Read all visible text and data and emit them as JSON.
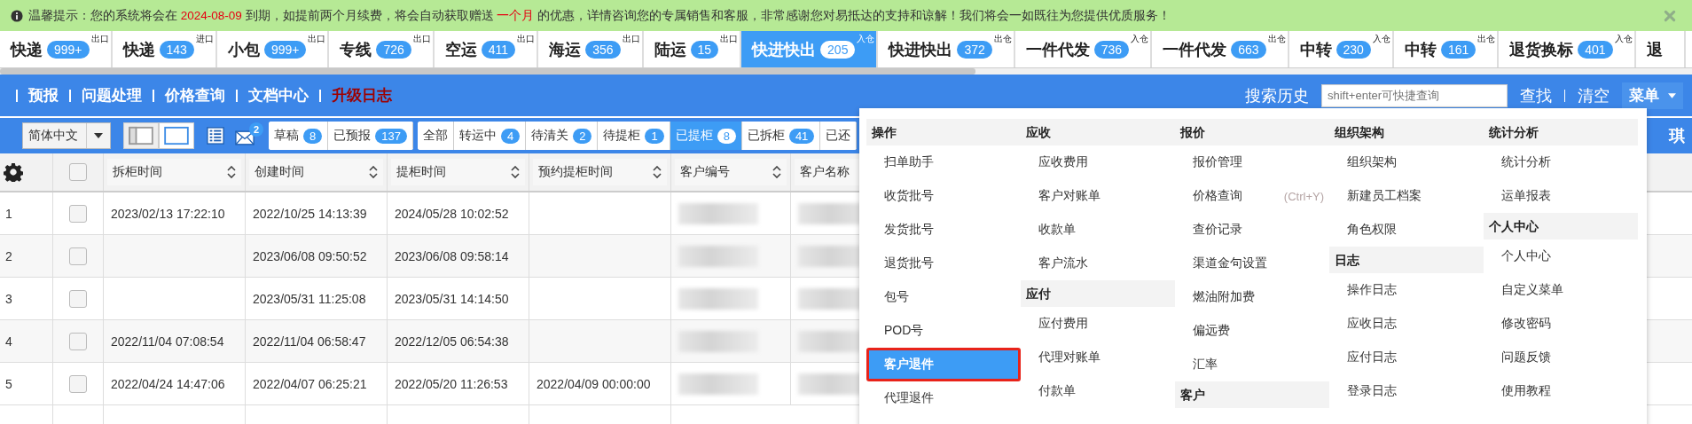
{
  "notice": {
    "segments": [
      {
        "text": "温馨提示：您的系统将会在 ",
        "kind": "plain"
      },
      {
        "text": "2024-08-09",
        "kind": "highlight"
      },
      {
        "text": " 到期，如提前两个月续费，将会自动获取赠送 ",
        "kind": "plain"
      },
      {
        "text": "一个月",
        "kind": "highlight"
      },
      {
        "text": " 的优惠，详情咨询您的专属销售和客服，非常感谢您对易抵达的支持和谅解！我们将会一如既往为您提供优质服务！",
        "kind": "plain"
      }
    ]
  },
  "tabs": [
    {
      "label": "快递",
      "count": "999+",
      "tag": "出口",
      "selected": false
    },
    {
      "label": "快递",
      "count": "143",
      "tag": "进口",
      "selected": false
    },
    {
      "label": "小包",
      "count": "999+",
      "tag": "出口",
      "selected": false
    },
    {
      "label": "专线",
      "count": "726",
      "tag": "出口",
      "selected": false
    },
    {
      "label": "空运",
      "count": "411",
      "tag": "出口",
      "selected": false
    },
    {
      "label": "海运",
      "count": "356",
      "tag": "出口",
      "selected": false
    },
    {
      "label": "陆运",
      "count": "15",
      "tag": "出口",
      "selected": false
    },
    {
      "label": "快进快出",
      "count": "205",
      "tag": "入仓",
      "selected": true
    },
    {
      "label": "快进快出",
      "count": "372",
      "tag": "出仓",
      "selected": false
    },
    {
      "label": "一件代发",
      "count": "736",
      "tag": "入仓",
      "selected": false
    },
    {
      "label": "一件代发",
      "count": "663",
      "tag": "出仓",
      "selected": false
    },
    {
      "label": "中转",
      "count": "230",
      "tag": "入仓",
      "selected": false
    },
    {
      "label": "中转",
      "count": "161",
      "tag": "出仓",
      "selected": false
    },
    {
      "label": "退货换标",
      "count": "401",
      "tag": "入仓",
      "selected": false
    },
    {
      "label": "退",
      "selected": false
    }
  ],
  "nav": {
    "links": [
      {
        "label": "预报",
        "kind": "normal"
      },
      {
        "label": "问题处理",
        "kind": "normal"
      },
      {
        "label": "价格查询",
        "kind": "normal"
      },
      {
        "label": "文档中心",
        "kind": "normal"
      },
      {
        "label": "升级日志",
        "kind": "alert"
      }
    ],
    "search_history": "搜索历史",
    "search": {
      "placeholder": "shift+enter可快捷查询"
    },
    "find": "查找",
    "clear": "清空",
    "menu": "菜单"
  },
  "toolbar": {
    "language": "简体中文",
    "mail_count": "2",
    "layouts": [
      {
        "selected": true
      },
      {
        "selected": false
      }
    ],
    "drafts": [
      {
        "label": "草稿",
        "count": "8"
      },
      {
        "label": "已预报",
        "count": "137"
      }
    ],
    "statuses": [
      {
        "label": "全部",
        "selected": false
      },
      {
        "label": "转运中",
        "count": "4",
        "selected": false
      },
      {
        "label": "待清关",
        "count": "2",
        "selected": false
      },
      {
        "label": "待提柜",
        "count": "1",
        "selected": false
      },
      {
        "label": "已提柜",
        "count": "8",
        "selected": true
      },
      {
        "label": "已拆柜",
        "count": "41",
        "selected": false
      },
      {
        "label": "已还",
        "selected": false
      }
    ],
    "user": "琪"
  },
  "table": {
    "select_all_checked": false,
    "columns": [
      "拆柜时间",
      "创建时间",
      "提柜时间",
      "预约提柜时间",
      "客户编号",
      "客户名称"
    ],
    "rows": [
      {
        "index": "1",
        "checked": false,
        "cells": [
          "2023/02/13 17:22:10",
          "2022/10/25 14:13:39",
          "2024/05/28 10:02:52",
          ""
        ]
      },
      {
        "index": "2",
        "checked": false,
        "cells": [
          "",
          "2023/06/08 09:50:52",
          "2023/06/08 09:58:14",
          ""
        ]
      },
      {
        "index": "3",
        "checked": false,
        "cells": [
          "",
          "2023/05/31 11:25:08",
          "2023/05/31 14:14:50",
          ""
        ]
      },
      {
        "index": "4",
        "checked": false,
        "cells": [
          "2022/11/04 07:08:54",
          "2022/11/04 06:58:47",
          "2022/12/05 06:54:38",
          ""
        ]
      },
      {
        "index": "5",
        "checked": false,
        "cells": [
          "2022/04/24 14:47:06",
          "2022/04/07 06:25:21",
          "2022/05/20 11:26:53",
          "2022/04/09 00:00:00"
        ]
      }
    ]
  },
  "menu_panel": {
    "columns": [
      [
        {
          "kind": "header",
          "label": "操作"
        },
        {
          "kind": "item",
          "label": "扫单助手",
          "selected": false
        },
        {
          "kind": "item",
          "label": "收货批号",
          "selected": false
        },
        {
          "kind": "item",
          "label": "发货批号",
          "selected": false
        },
        {
          "kind": "item",
          "label": "退货批号",
          "selected": false
        },
        {
          "kind": "item",
          "label": "包号",
          "selected": false
        },
        {
          "kind": "item",
          "label": "POD号",
          "selected": false
        },
        {
          "kind": "item",
          "label": "客户退件",
          "selected": true,
          "annotated": true
        },
        {
          "kind": "item",
          "label": "代理退件",
          "selected": false
        }
      ],
      [
        {
          "kind": "header",
          "label": "应收"
        },
        {
          "kind": "item",
          "label": "应收费用",
          "selected": false
        },
        {
          "kind": "item",
          "label": "客户对账单",
          "selected": false
        },
        {
          "kind": "item",
          "label": "收款单",
          "selected": false
        },
        {
          "kind": "item",
          "label": "客户流水",
          "selected": false
        },
        {
          "kind": "header",
          "label": "应付"
        },
        {
          "kind": "item",
          "label": "应付费用",
          "selected": false
        },
        {
          "kind": "item",
          "label": "代理对账单",
          "selected": false
        },
        {
          "kind": "item",
          "label": "付款单",
          "selected": false
        }
      ],
      [
        {
          "kind": "header",
          "label": "报价"
        },
        {
          "kind": "item",
          "label": "报价管理",
          "selected": false
        },
        {
          "kind": "item",
          "label": "价格查询",
          "shortcut": "(Ctrl+Y)",
          "selected": false
        },
        {
          "kind": "item",
          "label": "查价记录",
          "selected": false
        },
        {
          "kind": "item",
          "label": "渠道金句设置",
          "selected": false
        },
        {
          "kind": "item",
          "label": "燃油附加费",
          "selected": false
        },
        {
          "kind": "item",
          "label": "偏远费",
          "selected": false
        },
        {
          "kind": "item",
          "label": "汇率",
          "selected": false
        },
        {
          "kind": "header",
          "label": "客户"
        }
      ],
      [
        {
          "kind": "header",
          "label": "组织架构"
        },
        {
          "kind": "item",
          "label": "组织架构",
          "selected": false
        },
        {
          "kind": "item",
          "label": "新建员工档案",
          "selected": false
        },
        {
          "kind": "item",
          "label": "角色权限",
          "selected": false
        },
        {
          "kind": "header",
          "label": "日志"
        },
        {
          "kind": "item",
          "label": "操作日志",
          "selected": false
        },
        {
          "kind": "item",
          "label": "应收日志",
          "selected": false
        },
        {
          "kind": "item",
          "label": "应付日志",
          "selected": false
        },
        {
          "kind": "item",
          "label": "登录日志",
          "selected": false
        }
      ],
      [
        {
          "kind": "header",
          "label": "统计分析"
        },
        {
          "kind": "item",
          "label": "统计分析",
          "selected": false
        },
        {
          "kind": "item",
          "label": "运单报表",
          "selected": false
        },
        {
          "kind": "header",
          "label": "个人中心"
        },
        {
          "kind": "item",
          "label": "个人中心",
          "selected": false
        },
        {
          "kind": "item",
          "label": "自定义菜单",
          "selected": false
        },
        {
          "kind": "item",
          "label": "修改密码",
          "selected": false
        },
        {
          "kind": "item",
          "label": "问题反馈",
          "selected": false
        },
        {
          "kind": "item",
          "label": "使用教程",
          "selected": false
        }
      ]
    ]
  }
}
